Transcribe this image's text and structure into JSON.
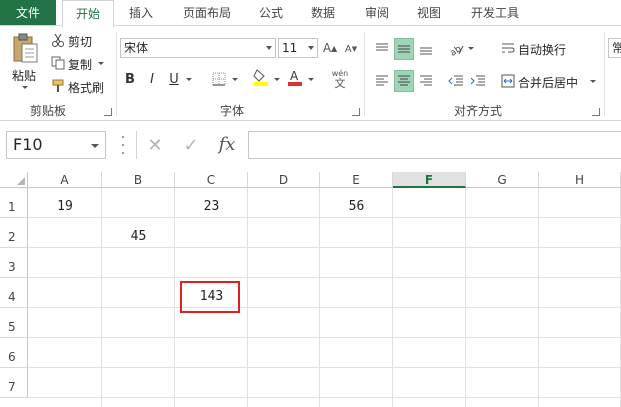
{
  "tabs": [
    {
      "id": "file",
      "label": "文件"
    },
    {
      "id": "home",
      "label": "开始"
    },
    {
      "id": "insert",
      "label": "插入"
    },
    {
      "id": "layout",
      "label": "页面布局"
    },
    {
      "id": "formulas",
      "label": "公式"
    },
    {
      "id": "data",
      "label": "数据"
    },
    {
      "id": "review",
      "label": "审阅"
    },
    {
      "id": "view",
      "label": "视图"
    },
    {
      "id": "developer",
      "label": "开发工具"
    }
  ],
  "clipboard": {
    "paste_label": "粘贴",
    "cut_label": "剪切",
    "copy_label": "复制",
    "format_painter_label": "格式刷",
    "group_label": "剪贴板"
  },
  "font": {
    "font_name": "宋体",
    "font_size": "11",
    "bold": "B",
    "italic": "I",
    "underline": "U",
    "wen_label": "wén",
    "wen_char": "文",
    "group_label": "字体"
  },
  "alignment": {
    "wrap_text_label": "自动换行",
    "merge_center_label": "合并后居中",
    "group_label": "对齐方式",
    "next_group_partial": "常"
  },
  "formula_bar": {
    "name_box": "F10",
    "fx": "fx",
    "formula": ""
  },
  "sheet": {
    "columns": [
      "A",
      "B",
      "C",
      "D",
      "E",
      "F",
      "G",
      "H"
    ],
    "selected_column": "F",
    "rows": [
      "1",
      "2",
      "3",
      "4",
      "5",
      "6",
      "7"
    ],
    "cells": {
      "A1": "19",
      "C1": "23",
      "E1": "56",
      "B2": "45",
      "C4": "143"
    },
    "highlighted_cell": "C4",
    "highlight_color": "#e02020"
  },
  "colors": {
    "accent": "#217346",
    "font_color_bar": "#e03030",
    "fill_color_bar": "#ffff00",
    "selected_button": "#9fd5b7"
  }
}
